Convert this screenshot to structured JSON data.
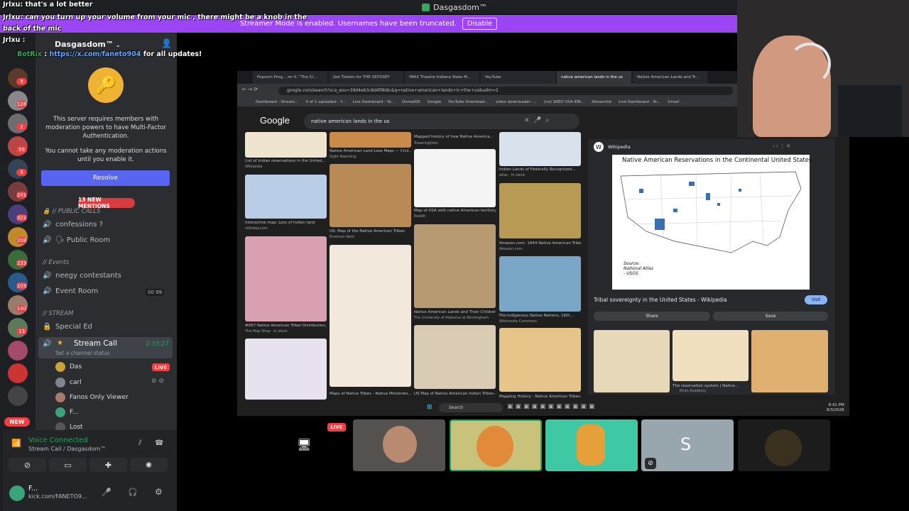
{
  "window": {
    "title": "Dasgasdom™"
  },
  "banner": {
    "text": "Streamer Mode is enabled. Usernames have been truncated.",
    "button": "Disable"
  },
  "chat": {
    "line1_user": "Jrlxu",
    "line1_text": ": that's a lot better",
    "line2_user": "Jrlxu",
    "line2_text": ": can you turn up your volume from your mic , there might be a knob in the",
    "line2_cont": "back ",
    "line2_cont2": " of the mic",
    "line3_user": "Jrlxu",
    "line4_user": "BotRix",
    "line4_link": "https://x.com/faneto904",
    "line4_text": " for all updates!"
  },
  "rail": {
    "badges": [
      "9",
      "126",
      "2",
      "56",
      "8",
      "241",
      "322",
      "208",
      "233",
      "103",
      "140",
      "13"
    ],
    "new_label": "NEW"
  },
  "server": {
    "name": "Dasgasdom™",
    "mfa_text1": "This server requires members with moderation powers to have Multi-Factor Authentication.",
    "mfa_text2": "You cannot take any moderation actions until you enable it.",
    "resolve": "Resolve"
  },
  "channels": {
    "mentions": "13 NEW MENTIONS",
    "cat_calls": "// PUBLIC CALLS",
    "confessions": "confessions ?",
    "public_room": "🗣 Public Room",
    "cat_events": "// Events",
    "neegy": "neegy contestants",
    "event_room": "Event Room",
    "event_count_a": "00",
    "event_count_b": "99",
    "cat_stream": "// STREAM",
    "special_ed": "Special Ed",
    "stream_call": "Stream Call",
    "stream_time": "2:33:27",
    "stream_status": "Set a channel status",
    "voice_users": [
      "Das",
      "carl",
      "Fanos Only Viewer",
      "F...",
      "Lost"
    ],
    "live": "LIVE"
  },
  "voice": {
    "connected": "Voice Connected",
    "location": "Stream Call / Dasgasdom™",
    "user": "F...",
    "user_status": "kick.com/FANETO9..."
  },
  "browser": {
    "tabs": [
      "Popcorn Prog... on X: \"The Cl...",
      "Get Tickets for THE ODYSSEY",
      "IMAX Theatre Indiana State M...",
      "YouTube",
      "native american lands in the us",
      "Native American Lands and Tr..."
    ],
    "url": "google.com/search?sca_esv=39d4eb3c8d4f9b8c&q=native+american+lands+in+the+us&udm=2",
    "bookmarks": [
      "Dashboard - Stream...",
      "0 of 1 uploaded - Y...",
      "Live Dashboard - Yo...",
      "DomalQS",
      "Google",
      "YouTube Download...",
      "video downloader -...",
      "(no) SKEO USA KIN...",
      "Streamlist",
      "Live Dashboard - St...",
      "Gmail"
    ],
    "query": "native american lands in the us",
    "logo": "Google"
  },
  "results": {
    "c1": [
      "List of Indian reservations in the United...",
      "Interactive map: Loss of Indian land",
      "#067 Native American Tribal Distribution,..."
    ],
    "c1src": [
      "Wikipedia",
      "stltoday.com",
      "The Map Shop · In stock"
    ],
    "c2": [
      "Native American Land Loss Maps — Civil...",
      "US: Map of the Native American Tribes",
      "Maps of Native Tribes - Native Ministries..."
    ],
    "c2src": [
      "Sight Reaching",
      "Emerson Kent",
      ""
    ],
    "c3": [
      "Mapped history of how Native America...",
      "Map of USA with native American territory...",
      "Native American Lands and Their Children...",
      "US Map of Native American Indian Tribes -..."
    ],
    "c3src": [
      "ToweringDoto",
      "Reddit",
      "The University of Alabama at Birmingham",
      ""
    ],
    "c4": [
      "Indian Lands of Federally Recognized...",
      "Amazon.com: 1944 Native American Tribal...",
      "File:Indigenous Native Nations, 16th...",
      "Mapping History - Native American Tribes..."
    ],
    "c4src": [
      "atlas · In stock",
      "Amazon.com",
      "Wikimedia Commons",
      ""
    ]
  },
  "preview": {
    "site": "Wikipedia",
    "map_title": "Native American Reservations in the Continental United States",
    "source_label": "Source:",
    "source_name": "National Atlas",
    "source_org": "- USGS",
    "title": "Tribal sovereignty in the United States - Wikipedia",
    "visit": "Visit",
    "share": "Share",
    "save": "Save",
    "related_caption": "The reservation system | Native...",
    "related_src": "Khan Academy"
  },
  "taskbar": {
    "search": "Search",
    "time": "8:41 PM",
    "date": "6/3/2026"
  },
  "tiles": {
    "live": "LIVE",
    "s_letter": "S"
  }
}
